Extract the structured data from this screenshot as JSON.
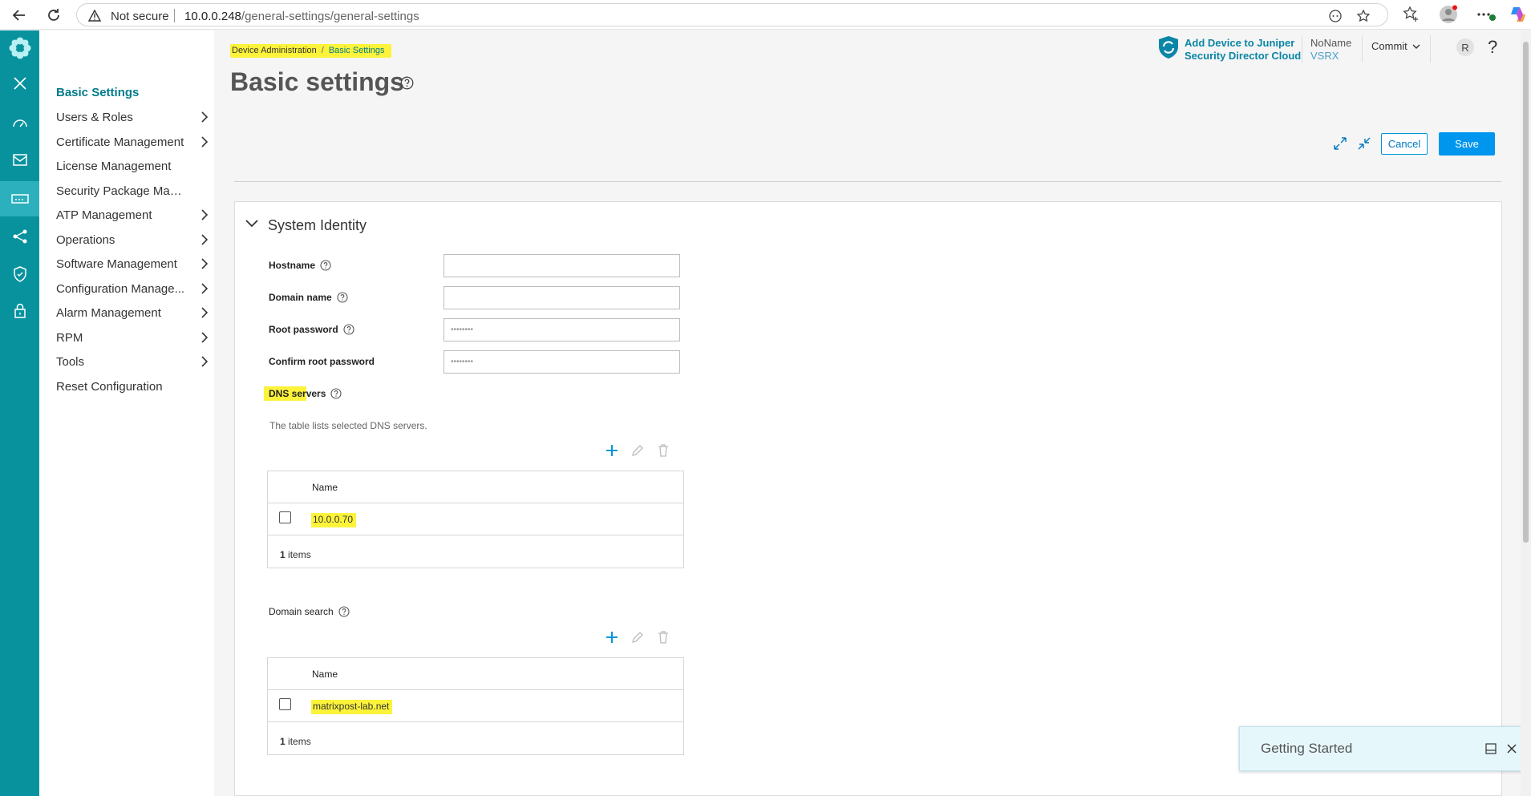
{
  "browser": {
    "security_label": "Not secure",
    "url_host": "10.0.0.248",
    "url_path": "/general-settings/general-settings"
  },
  "rail": {
    "active_index": 4,
    "items": [
      "logo-icon",
      "close-icon",
      "dashboard-icon",
      "monitor-icon",
      "device-icon",
      "network-icon",
      "security-icon",
      "lock-icon"
    ]
  },
  "subnav": {
    "items": [
      {
        "label": "Basic Settings",
        "active": true,
        "chevron": false
      },
      {
        "label": "Users & Roles",
        "active": false,
        "chevron": true
      },
      {
        "label": "Certificate Management",
        "active": false,
        "chevron": true
      },
      {
        "label": "License Management",
        "active": false,
        "chevron": false
      },
      {
        "label": "Security Package Man...",
        "active": false,
        "chevron": false
      },
      {
        "label": "ATP Management",
        "active": false,
        "chevron": true
      },
      {
        "label": "Operations",
        "active": false,
        "chevron": true
      },
      {
        "label": "Software Management",
        "active": false,
        "chevron": true
      },
      {
        "label": "Configuration Manage...",
        "active": false,
        "chevron": true
      },
      {
        "label": "Alarm Management",
        "active": false,
        "chevron": true
      },
      {
        "label": "RPM",
        "active": false,
        "chevron": true
      },
      {
        "label": "Tools",
        "active": false,
        "chevron": true
      },
      {
        "label": "Reset Configuration",
        "active": false,
        "chevron": false
      }
    ]
  },
  "breadcrumb": {
    "parent": "Device Administration",
    "separator": "/",
    "current": "Basic Settings"
  },
  "page": {
    "title": "Basic settings"
  },
  "header": {
    "jsd_line1": "Add Device to Juniper",
    "jsd_line2": "Security Director Cloud",
    "device_name": "NoName",
    "device_model": "VSRX",
    "commit_label": "Commit",
    "avatar_initial": "R",
    "help_label": "?"
  },
  "actions": {
    "cancel_label": "Cancel",
    "save_label": "Save"
  },
  "system_identity": {
    "section_title": "System Identity",
    "hostname_label": "Hostname",
    "hostname_value": "",
    "domain_label": "Domain name",
    "domain_value": "",
    "root_password_label": "Root password",
    "root_password_value": "••••••••",
    "confirm_password_label": "Confirm root password",
    "confirm_password_value": "••••••••"
  },
  "dns": {
    "label_a": "DNS ser",
    "label_b": "vers",
    "description": "The table lists selected DNS servers.",
    "column": "Name",
    "rows": [
      "10.0.0.70"
    ],
    "count": "1",
    "count_suffix": " items"
  },
  "domain_search": {
    "label": "Domain search",
    "column": "Name",
    "rows": [
      "matrixpost-lab.net"
    ],
    "count": "1",
    "count_suffix": " items"
  },
  "toast": {
    "title": "Getting Started"
  },
  "colors": {
    "rail": "#08929e",
    "rail_active": "#2cb0bd",
    "accent": "#007b8a",
    "primary_button": "#0096ee",
    "highlight": "#fcf33a"
  }
}
